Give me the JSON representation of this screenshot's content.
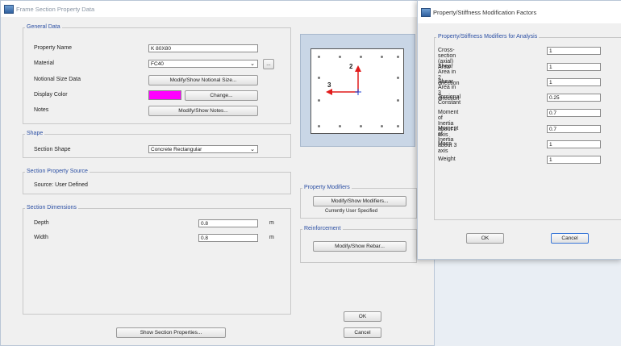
{
  "main_window": {
    "title": "Frame Section Property Data",
    "general_data": {
      "group_title": "General Data",
      "property_name_label": "Property Name",
      "property_name_value": "K 80X80",
      "material_label": "Material",
      "material_value": "FC40",
      "material_more_button": "...",
      "notional_size_label": "Notional Size Data",
      "notional_size_button": "Modify/Show Notional Size...",
      "display_color_label": "Display Color",
      "display_color": "#ff00ff",
      "change_button": "Change...",
      "notes_label": "Notes",
      "notes_button": "Modify/Show Notes..."
    },
    "shape": {
      "group_title": "Shape",
      "section_shape_label": "Section Shape",
      "section_shape_value": "Concrete Rectangular"
    },
    "source": {
      "group_title": "Section Property Source",
      "source_text": "Source:  User Defined"
    },
    "dimensions": {
      "group_title": "Section Dimensions",
      "depth_label": "Depth",
      "depth_value": "0.8",
      "depth_unit": "m",
      "width_label": "Width",
      "width_value": "0.8",
      "width_unit": "m"
    },
    "preview": {
      "axis2_label": "2",
      "axis3_label": "3",
      "axis_color": "#e11b1b",
      "bg_color": "#ffffff"
    },
    "property_modifiers": {
      "group_title": "Property Modifiers",
      "button": "Modify/Show Modifiers...",
      "status": "Currently User Specified"
    },
    "reinforcement": {
      "group_title": "Reinforcement",
      "button": "Modify/Show Rebar..."
    },
    "show_section_properties_button": "Show Section Properties...",
    "ok_button": "OK",
    "cancel_button": "Cancel"
  },
  "modifiers_dialog": {
    "title": "Property/Stiffness Modification Factors",
    "group_title": "Property/Stiffness Modifiers for Analysis",
    "rows": [
      {
        "label": "Cross-section (axial) Area",
        "value": "1"
      },
      {
        "label": "Shear Area in 2 direction",
        "value": "1"
      },
      {
        "label": "Shear Area in 3 direction",
        "value": "1"
      },
      {
        "label": "Torsional Constant",
        "value": "0.25"
      },
      {
        "label": "Moment of Inertia about 2 axis",
        "value": "0.7"
      },
      {
        "label": "Moment of Inertia about 3 axis",
        "value": "0.7"
      },
      {
        "label": "Mass",
        "value": "1"
      },
      {
        "label": "Weight",
        "value": "1"
      }
    ],
    "ok_button": "OK",
    "cancel_button": "Cancel"
  }
}
